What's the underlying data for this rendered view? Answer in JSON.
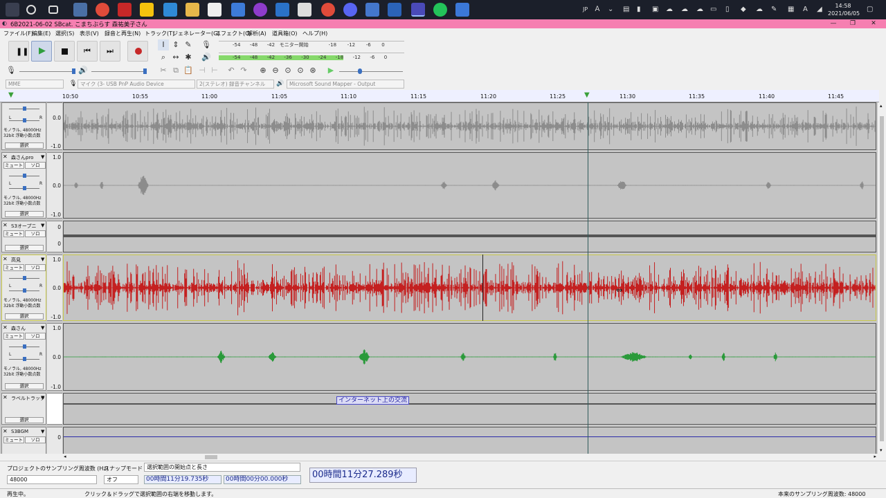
{
  "taskbar": {
    "lang": "JP",
    "time": "14:58",
    "date": "2021/06/05",
    "apps": [
      "settings-icon",
      "search-icon",
      "taskview-icon",
      "explorer-icon",
      "chrome-icon",
      "app-red-icon",
      "sticky-icon",
      "mail-icon",
      "folder-icon",
      "teams-icon",
      "check-icon",
      "podcast-icon",
      "browser-icon",
      "notes-icon",
      "chrome2-icon",
      "discord-icon",
      "audio-icon",
      "audacity-icon",
      "line-icon",
      "gear-icon"
    ]
  },
  "window": {
    "title": "6B2021-06-02 SBcat. こまちぶらす 森祐美子さん",
    "min": "—",
    "max": "❐",
    "close": "✕"
  },
  "menu": [
    "ファイル(F)",
    "編集(E)",
    "選択(S)",
    "表示(V)",
    "録音と再生(N)",
    "トラック(T)",
    "ジェネレーター(G)",
    "エフェクト(C)",
    "解析(A)",
    "道具箱(O)",
    "ヘルプ(H)"
  ],
  "meter": {
    "rec_scale": [
      "-54",
      "-48",
      "-42",
      "モニター開始",
      "-18",
      "-12",
      "-6",
      "0"
    ],
    "play_scale": [
      "-54",
      "-48",
      "-42",
      "-36",
      "-30",
      "-24",
      "-18",
      "-12",
      "-6",
      "0"
    ],
    "play_level": 0.67
  },
  "device": {
    "host": "MME",
    "input": "マイク (3- USB PnP Audio Device",
    "channels": "2(ステレオ) 録音チャンネル",
    "output": "Microsoft Sound Mapper - Output"
  },
  "ruler": {
    "ticks": [
      "10:50",
      "10:55",
      "11:00",
      "11:05",
      "11:10",
      "11:15",
      "11:20",
      "11:25",
      "11:30",
      "11:35",
      "11:40",
      "11:45"
    ]
  },
  "track_common": {
    "mute": "ミュート",
    "solo": "ソロ",
    "select": "選択",
    "info1": "モノラル, 48000Hz",
    "info2": "32bit 浮動小数点数",
    "scale_top": "1.0",
    "scale_mid": "0.0",
    "scale_bot": "-1.0",
    "scale_zero": "0",
    "pan_l": "L",
    "pan_r": "R"
  },
  "tracks": [
    {
      "name": ""
    },
    {
      "name": "森さんpro"
    },
    {
      "name": "S3オープニ"
    },
    {
      "name": "高見"
    },
    {
      "name": "森さん"
    },
    {
      "name": "ラベルトラック"
    },
    {
      "name": "S3BGM"
    }
  ],
  "label": {
    "text": "インターネット上の交流"
  },
  "selection": {
    "rate_label": "プロジェクトのサンプリング周波数 (Hz)",
    "rate_value": "48000",
    "snap_label": "スナップモード",
    "snap_value": "オフ",
    "mode_label": "選択範囲の開始点と長さ",
    "start": "00時間11分19.735秒",
    "length": "00時間00分00.000秒",
    "position": "00時間11分27.289秒"
  },
  "status": {
    "state": "再生中。",
    "hint": "クリック＆ドラッグで選択範囲の右端を移動します。",
    "rate": "本来のサンプリング周波数: 48000"
  }
}
